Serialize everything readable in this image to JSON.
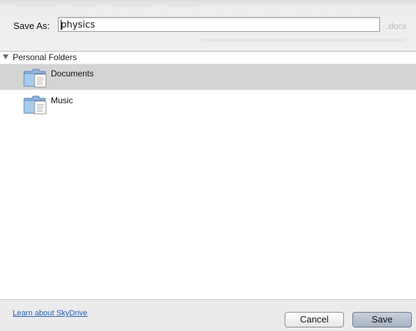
{
  "save_as": {
    "label": "Save As:",
    "value": "physics",
    "extension": ".docx"
  },
  "folders": {
    "group_label": "Personal Folders",
    "items": [
      {
        "label": "Documents",
        "selected": true
      },
      {
        "label": "Music",
        "selected": false
      }
    ]
  },
  "footer": {
    "link_label": "Learn about SkyDrive",
    "cancel_label": "Cancel",
    "save_label": "Save"
  },
  "colors": {
    "selection": "#d4d4d4",
    "link": "#2a5db0",
    "folder_icon": "#9cc0e3"
  }
}
